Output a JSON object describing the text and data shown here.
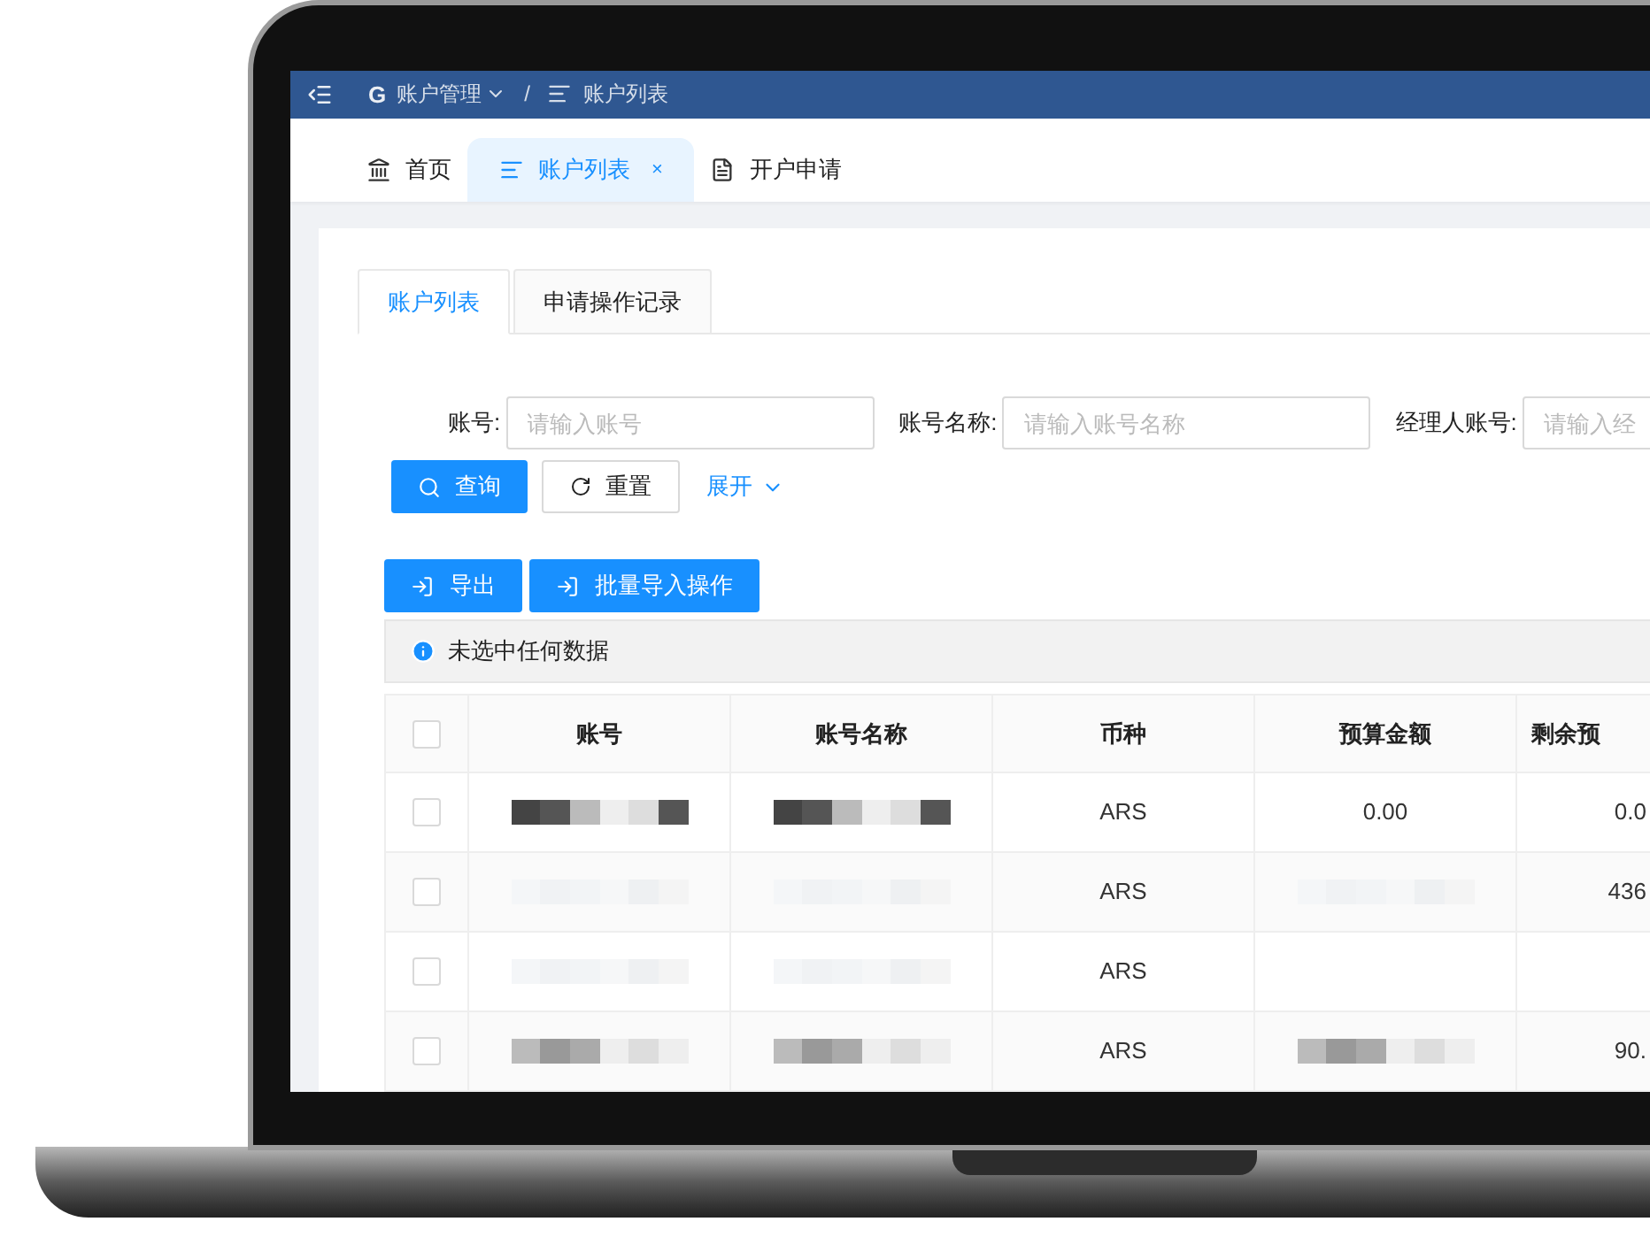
{
  "header": {
    "logo": "G",
    "breadcrumb": [
      {
        "label": "账户管理",
        "dropdown": true
      },
      {
        "label": "账户列表",
        "dropdown": false
      }
    ],
    "separator": "/"
  },
  "page_tabs": [
    {
      "label": "首页",
      "selected": false
    },
    {
      "label": "账户列表",
      "selected": true,
      "close": "×"
    },
    {
      "label": "开户申请",
      "selected": false
    }
  ],
  "sub_tabs": [
    {
      "label": "账户列表",
      "selected": true
    },
    {
      "label": "申请操作记录",
      "selected": false
    }
  ],
  "filters": [
    {
      "label": "账号:",
      "placeholder": "请输入账号"
    },
    {
      "label": "账号名称:",
      "placeholder": "请输入账号名称"
    },
    {
      "label": "经理人账号:",
      "placeholder": "请输入经"
    }
  ],
  "search_button": "查询",
  "reset_button": "重置",
  "expand_link": "展开",
  "actions": [
    "导出",
    "批量导入操作"
  ],
  "alert": "未选中任何数据",
  "table": {
    "columns": [
      "账号",
      "账号名称",
      "币种",
      "预算金额",
      "剩余预"
    ],
    "header_checked": false,
    "rows": [
      {
        "checked": false,
        "cells": [
          {
            "kind": "redacted"
          },
          {
            "kind": "redacted"
          },
          {
            "kind": "text",
            "text": "ARS"
          },
          {
            "kind": "text",
            "text": "0.00"
          },
          {
            "kind": "text",
            "text": "0.0"
          }
        ]
      },
      {
        "checked": false,
        "cells": [
          {
            "kind": "redacted"
          },
          {
            "kind": "redacted"
          },
          {
            "kind": "text",
            "text": "ARS"
          },
          {
            "kind": "redacted"
          },
          {
            "kind": "text",
            "text": "436"
          }
        ]
      },
      {
        "checked": false,
        "cells": [
          {
            "kind": "redacted"
          },
          {
            "kind": "redacted"
          },
          {
            "kind": "text",
            "text": "ARS"
          },
          {
            "kind": "empty"
          },
          {
            "kind": "empty"
          }
        ]
      },
      {
        "checked": false,
        "cells": [
          {
            "kind": "redacted"
          },
          {
            "kind": "redacted"
          },
          {
            "kind": "text",
            "text": "ARS"
          },
          {
            "kind": "redacted"
          },
          {
            "kind": "text",
            "text": "90."
          }
        ]
      }
    ]
  }
}
